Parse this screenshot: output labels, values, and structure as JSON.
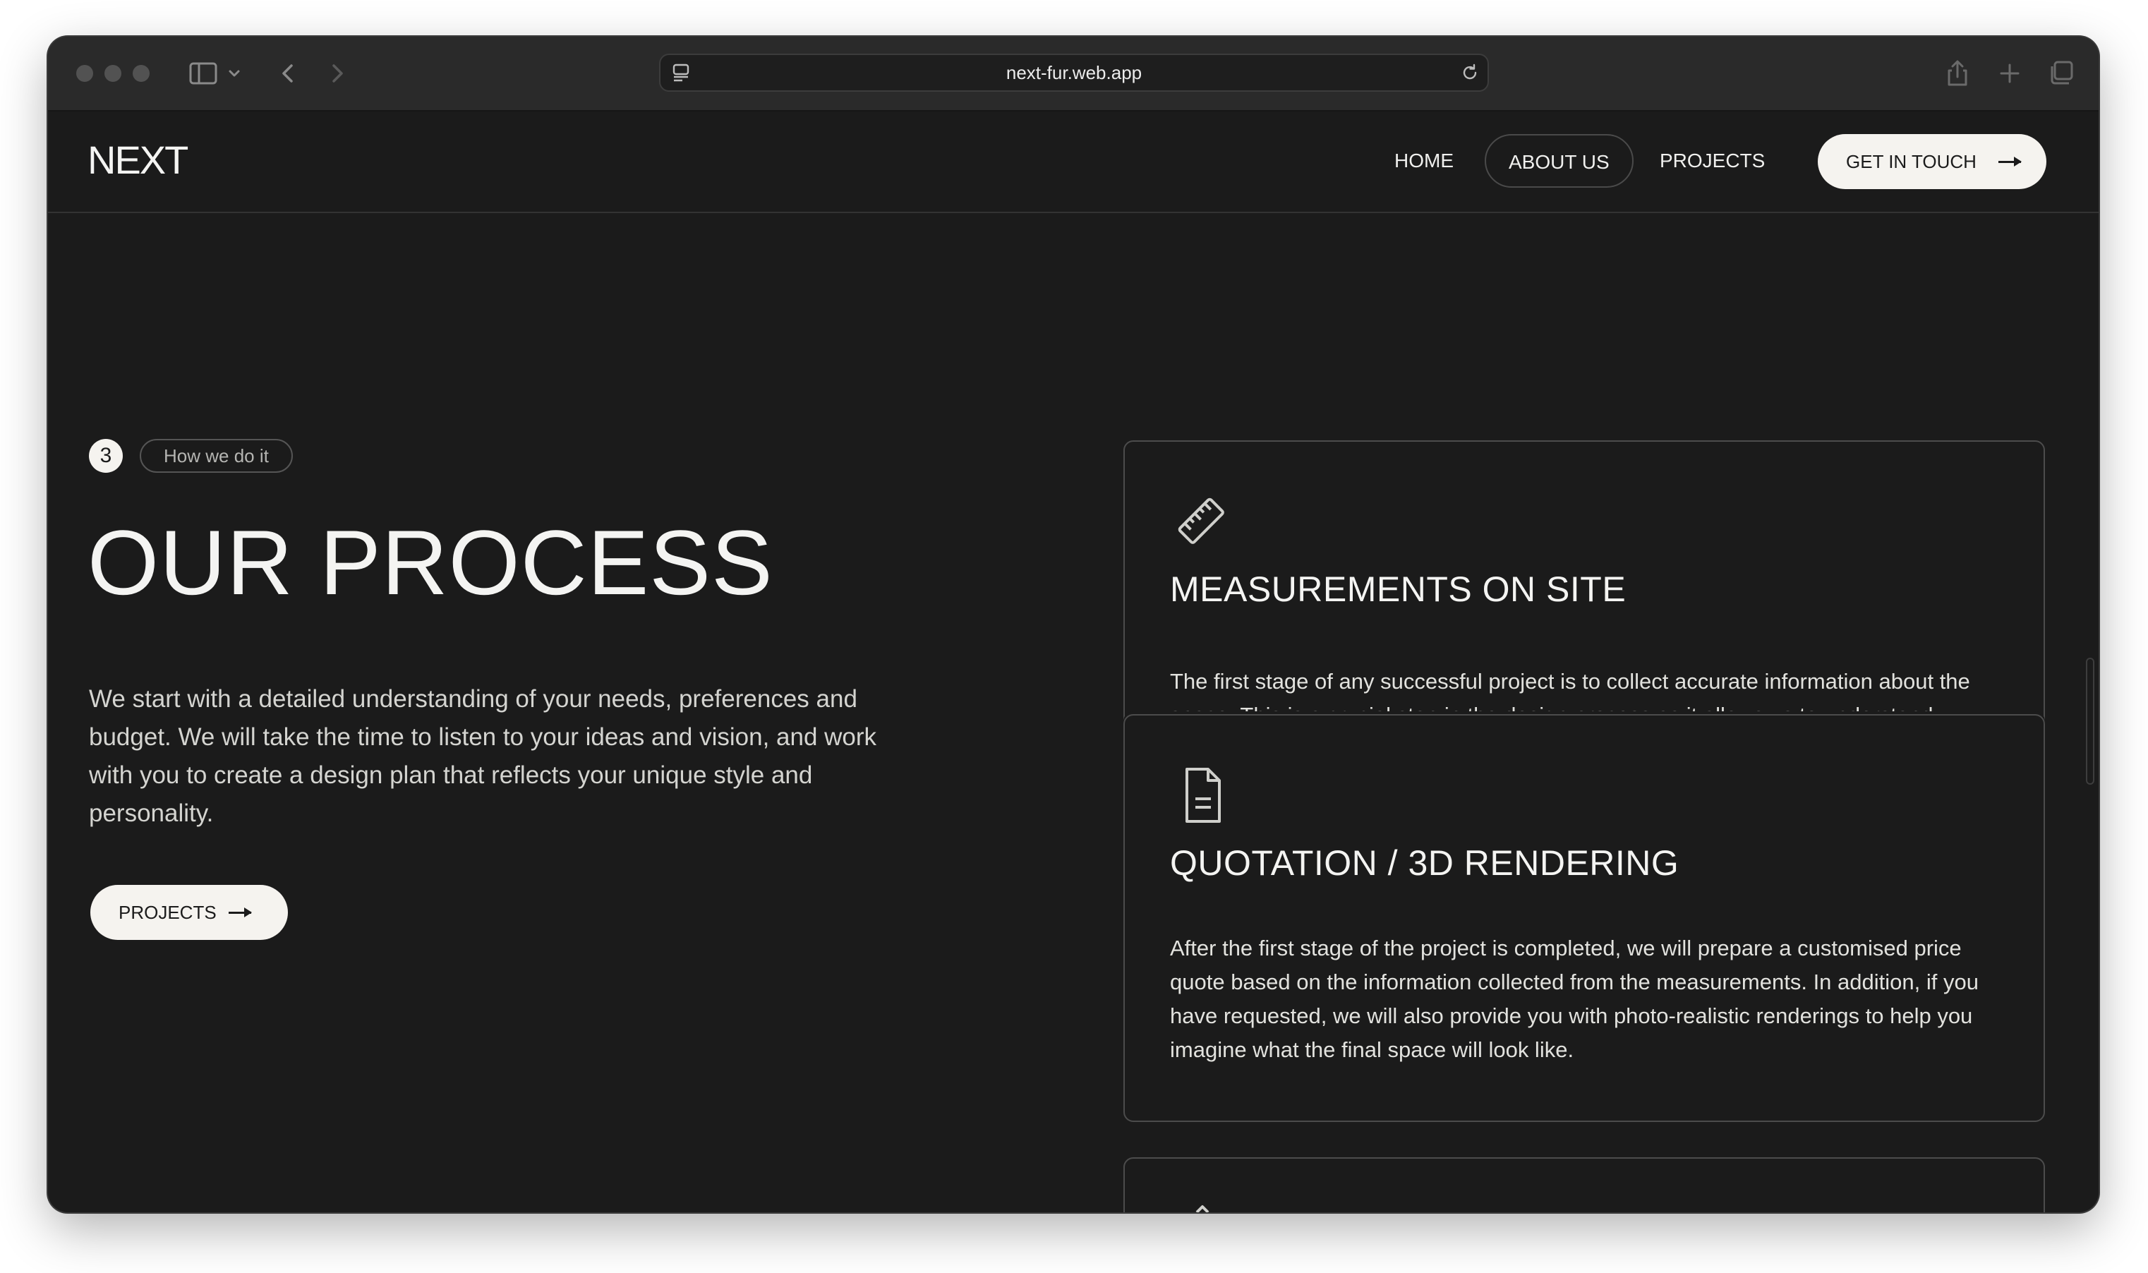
{
  "browser": {
    "url": "next-fur.web.app"
  },
  "site": {
    "logo": "NEXT",
    "nav": {
      "home": "HOME",
      "about": "ABOUT US",
      "projects": "PROJECTS"
    },
    "cta_label": "GET IN TOUCH"
  },
  "section": {
    "step_number": "3",
    "tag": "How we do it",
    "title": "OUR PROCESS",
    "description": "We start with a detailed understanding of your needs, preferences and budget. We will take the time to listen to your ideas and vision, and work with you to create a design plan that reflects your unique style and personality.",
    "button_label": "PROJECTS"
  },
  "cards": [
    {
      "icon": "ruler-icon",
      "title": "MEASUREMENTS ON SITE",
      "body": "The first stage of any successful project is to collect accurate information about the space. This is a crucial step in the design process as it allows us to understand"
    },
    {
      "icon": "document-icon",
      "title": "QUOTATION / 3D RENDERING",
      "body": "After the first stage of the project is completed, we will prepare a customised price quote based on the information collected from the measurements. In addition, if you have requested, we will also provide you with photo-realistic renderings to help you imagine what the final space will look like."
    }
  ],
  "colors": {
    "background": "#1b1b1b",
    "titlebar": "#2a2a2a",
    "text": "#f4f4f2",
    "button_bg": "#f5f3ef",
    "border": "#4c4c4c"
  }
}
